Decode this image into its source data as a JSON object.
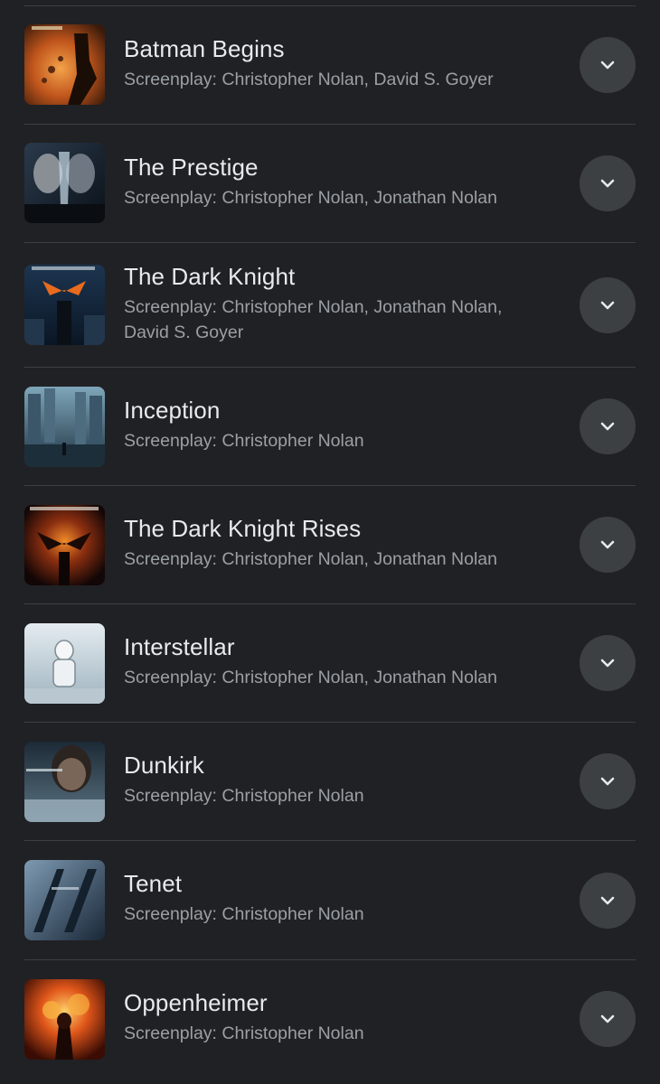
{
  "movies": [
    {
      "title": "Batman Begins",
      "credit": "Screenplay: Christopher Nolan, David S. Goyer",
      "poster_icon": "batman-begins-poster"
    },
    {
      "title": "The Prestige",
      "credit": "Screenplay: Christopher Nolan, Jonathan Nolan",
      "poster_icon": "the-prestige-poster"
    },
    {
      "title": "The Dark Knight",
      "credit": "Screenplay: Christopher Nolan, Jonathan Nolan, David S. Goyer",
      "poster_icon": "the-dark-knight-poster"
    },
    {
      "title": "Inception",
      "credit": "Screenplay: Christopher Nolan",
      "poster_icon": "inception-poster"
    },
    {
      "title": "The Dark Knight Rises",
      "credit": "Screenplay: Christopher Nolan, Jonathan Nolan",
      "poster_icon": "the-dark-knight-rises-poster"
    },
    {
      "title": "Interstellar",
      "credit": "Screenplay: Christopher Nolan, Jonathan Nolan",
      "poster_icon": "interstellar-poster"
    },
    {
      "title": "Dunkirk",
      "credit": "Screenplay: Christopher Nolan",
      "poster_icon": "dunkirk-poster"
    },
    {
      "title": "Tenet",
      "credit": "Screenplay: Christopher Nolan",
      "poster_icon": "tenet-poster"
    },
    {
      "title": "Oppenheimer",
      "credit": "Screenplay: Christopher Nolan",
      "poster_icon": "oppenheimer-poster"
    }
  ],
  "expand_icon": "chevron-down-icon",
  "colors": {
    "background": "#202124",
    "title_text": "#e8eaed",
    "subtitle_text": "#9aa0a6",
    "button_bg": "#3c4043",
    "divider": "#3c4043"
  }
}
